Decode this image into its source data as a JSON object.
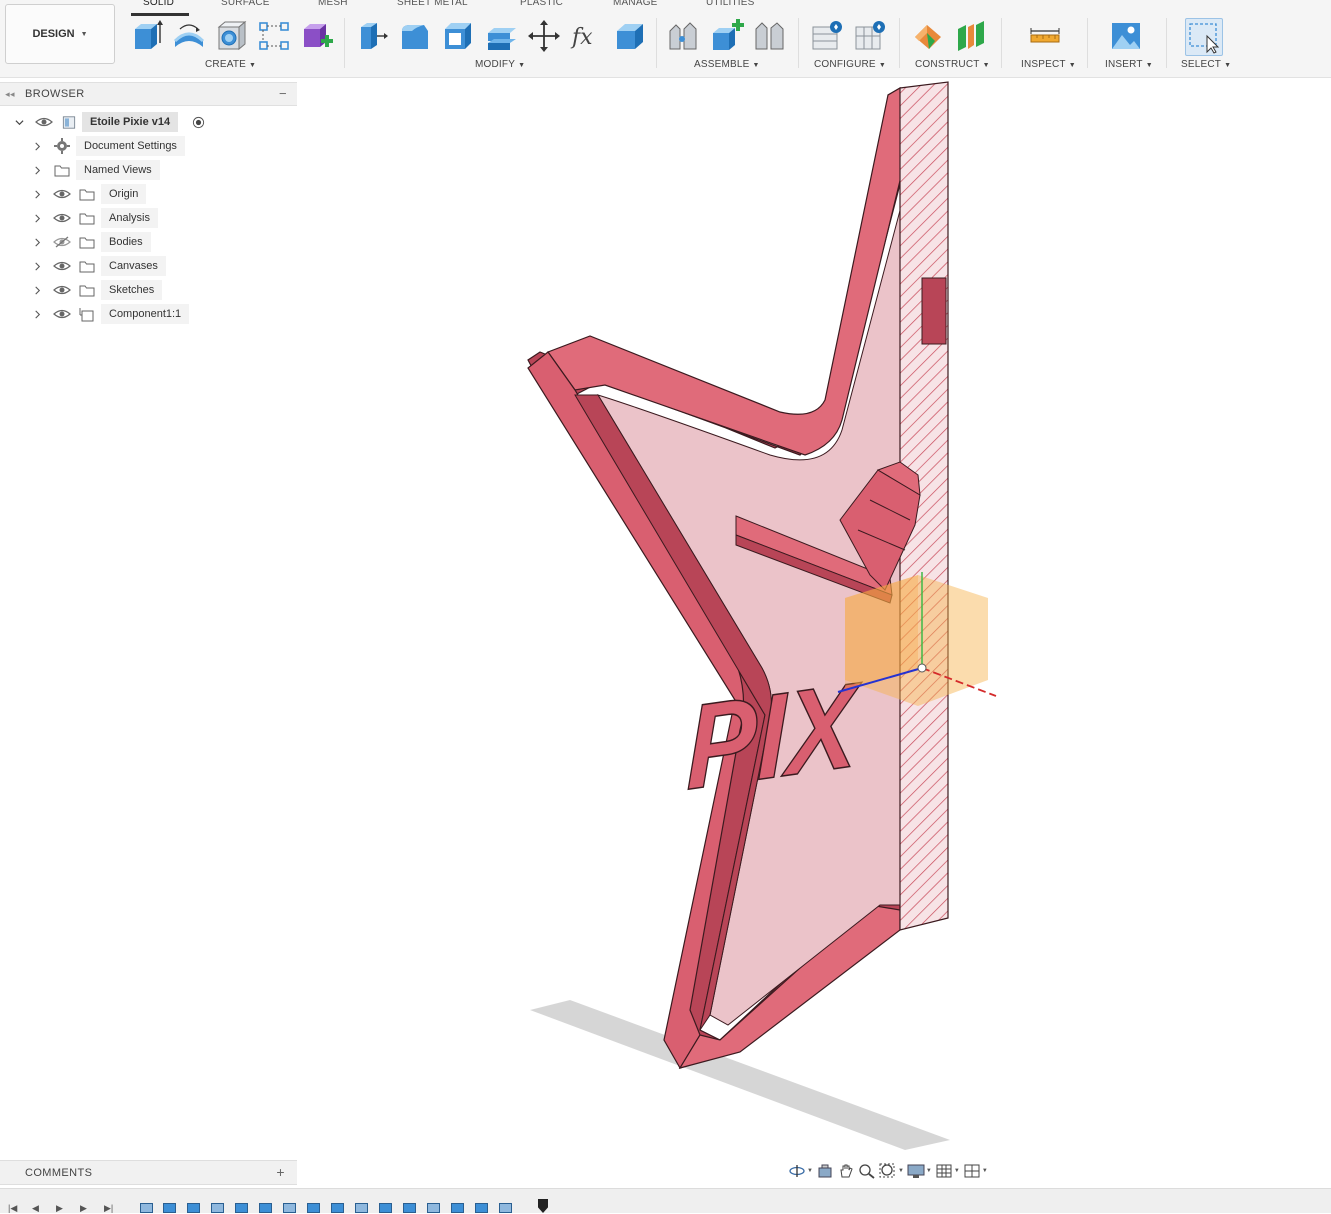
{
  "workspace": {
    "label": "DESIGN"
  },
  "tabs": [
    {
      "label": "SOLID",
      "active": true
    },
    {
      "label": "SURFACE"
    },
    {
      "label": "MESH"
    },
    {
      "label": "SHEET METAL"
    },
    {
      "label": "PLASTIC"
    },
    {
      "label": "MANAGE"
    },
    {
      "label": "UTILITIES"
    }
  ],
  "groups": {
    "create": "CREATE",
    "modify": "MODIFY",
    "assemble": "ASSEMBLE",
    "configure": "CONFIGURE",
    "construct": "CONSTRUCT",
    "inspect": "INSPECT",
    "insert": "INSERT",
    "select": "SELECT"
  },
  "icons": {
    "create": [
      "extrude-icon",
      "revolve-icon",
      "hole-icon",
      "sketch-pattern-icon",
      "new-component-icon"
    ],
    "modify": [
      "press-pull-icon",
      "fillet-icon",
      "shell-icon",
      "combine-icon",
      "move-icon",
      "parameters-icon",
      "replace-face-icon"
    ],
    "assemble": [
      "joint-icon",
      "new-component-assemble-icon",
      "as-built-joint-icon"
    ],
    "configure": [
      "configure-table-icon",
      "configure-rule-icon"
    ],
    "construct": [
      "offset-plane-icon",
      "midplane-icon"
    ],
    "inspect": [
      "measure-icon"
    ],
    "insert": [
      "insert-image-icon"
    ],
    "select": [
      "window-select-icon"
    ]
  },
  "browser": {
    "title": "BROWSER",
    "root": {
      "label": "Etoile Pixie v14"
    },
    "items": [
      {
        "label": "Document Settings",
        "icon": "gear-icon",
        "visibility": "none"
      },
      {
        "label": "Named Views",
        "icon": "folder-icon",
        "visibility": "none"
      },
      {
        "label": "Origin",
        "icon": "folder-icon",
        "visibility": "visible"
      },
      {
        "label": "Analysis",
        "icon": "folder-icon",
        "visibility": "visible"
      },
      {
        "label": "Bodies",
        "icon": "folder-icon",
        "visibility": "hidden"
      },
      {
        "label": "Canvases",
        "icon": "folder-icon",
        "visibility": "visible"
      },
      {
        "label": "Sketches",
        "icon": "folder-icon",
        "visibility": "visible"
      },
      {
        "label": "Component1:1",
        "icon": "component-icon",
        "visibility": "visible"
      }
    ]
  },
  "viewport": {
    "model_text": "PIX",
    "model_color": "#e06b7a"
  },
  "comments": {
    "title": "COMMENTS"
  },
  "nav_icons": [
    "orbit-icon",
    "look-at-icon",
    "pan-icon",
    "zoom-icon",
    "fit-icon",
    "display-settings-icon",
    "grid-icon",
    "viewports-icon"
  ],
  "playback_icons": [
    "first-frame-icon",
    "previous-frame-icon",
    "play-icon",
    "next-frame-icon",
    "last-frame-icon"
  ],
  "colors": {
    "accent": "#0696d7",
    "toolbar_bg": "#f5f5f5",
    "body_pink": "#e06b7a"
  }
}
